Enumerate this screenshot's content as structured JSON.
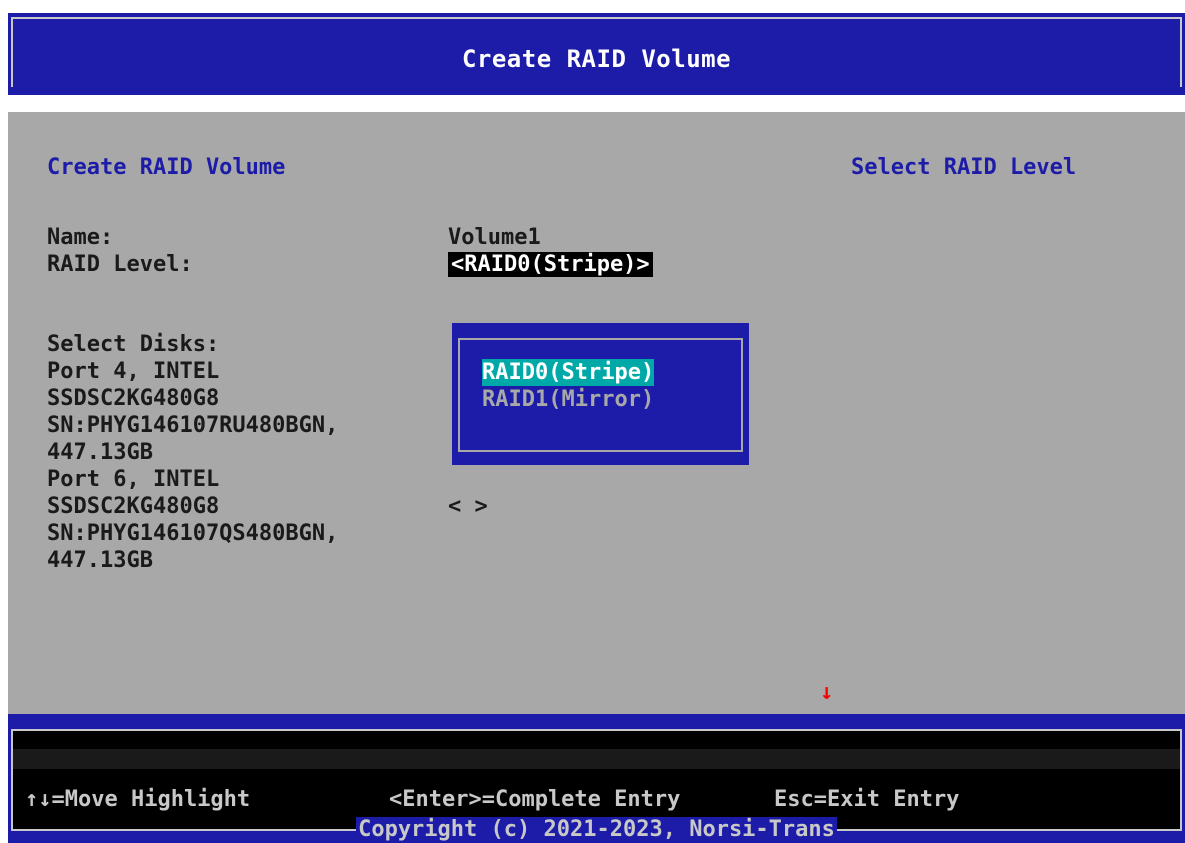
{
  "window": {
    "title": "Create RAID Volume"
  },
  "form": {
    "section_title": "Create RAID Volume",
    "help_text": "Select RAID Level",
    "name_label": "Name:",
    "name_value": "Volume1",
    "raid_level_label": "RAID Level:",
    "raid_level_value": "<RAID0(Stripe)>",
    "select_disks_label": "Select Disks:",
    "disks": [
      {
        "lines": [
          "Port 4, INTEL",
          "SSDSC2KG480G8",
          "SN:PHYG146107RU480BGN,",
          "447.13GB"
        ],
        "value": "< >"
      },
      {
        "lines": [
          "Port 6, INTEL",
          "SSDSC2KG480G8",
          "SN:PHYG146107QS480BGN,",
          "447.13GB"
        ],
        "value": "< >"
      }
    ]
  },
  "popup": {
    "options": [
      "RAID0(Stripe)",
      "RAID1(Mirror)"
    ],
    "highlighted": "RAID0(Stripe)"
  },
  "indicators": {
    "scroll_down": "↓"
  },
  "footer": {
    "help": [
      "↑↓=Move Highlight",
      "<Enter>=Complete Entry",
      "Esc=Exit Entry"
    ],
    "copyright": "Copyright (c) 2021-2023, Norsi-Trans"
  },
  "colors": {
    "title_bar": "#1c1ca8",
    "content_bg": "#a8a8a8",
    "heading": "#1c1ca8",
    "highlight": "#00a8a8",
    "scroll_arrow": "#ff0000"
  }
}
